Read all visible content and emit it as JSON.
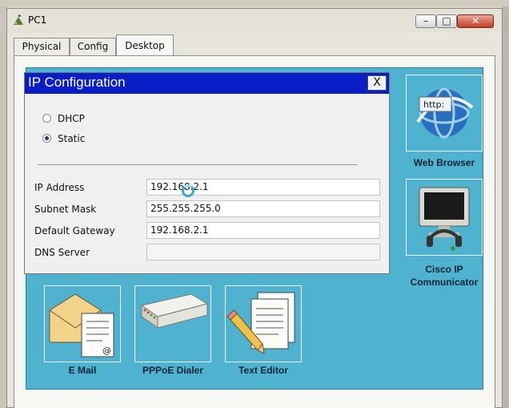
{
  "window": {
    "title": "PC1",
    "minimize_glyph": "–",
    "maximize_glyph": "□",
    "close_glyph": "✕"
  },
  "tabs": [
    {
      "label": "Physical"
    },
    {
      "label": "Config"
    },
    {
      "label": "Desktop",
      "selected": true
    }
  ],
  "dialog": {
    "title": "IP Configuration",
    "close_label": "X",
    "dhcp_label": "DHCP",
    "static_label": "Static",
    "selected_mode": "Static",
    "fields": [
      {
        "label": "IP Address",
        "value": "192.168.2.1"
      },
      {
        "label": "Subnet Mask",
        "value": "255.255.255.0"
      },
      {
        "label": "Default Gateway",
        "value": "192.168.2.1"
      },
      {
        "label": "DNS Server",
        "value": ""
      }
    ]
  },
  "apps": [
    {
      "label": "Web Browser",
      "icon": "web-browser-icon",
      "icon_text": "http:"
    },
    {
      "label": "Cisco IP Communicator",
      "icon": "ip-communicator-icon"
    },
    {
      "label": "E Mail",
      "icon": "email-icon"
    },
    {
      "label": "PPPoE Dialer",
      "icon": "pppoe-dialer-icon"
    },
    {
      "label": "Text Editor",
      "icon": "text-editor-icon"
    }
  ],
  "colors": {
    "desktop_bg": "#4fb3cf",
    "dialog_title_bg": "#0a1ec8",
    "close_button": "#c63b26"
  }
}
